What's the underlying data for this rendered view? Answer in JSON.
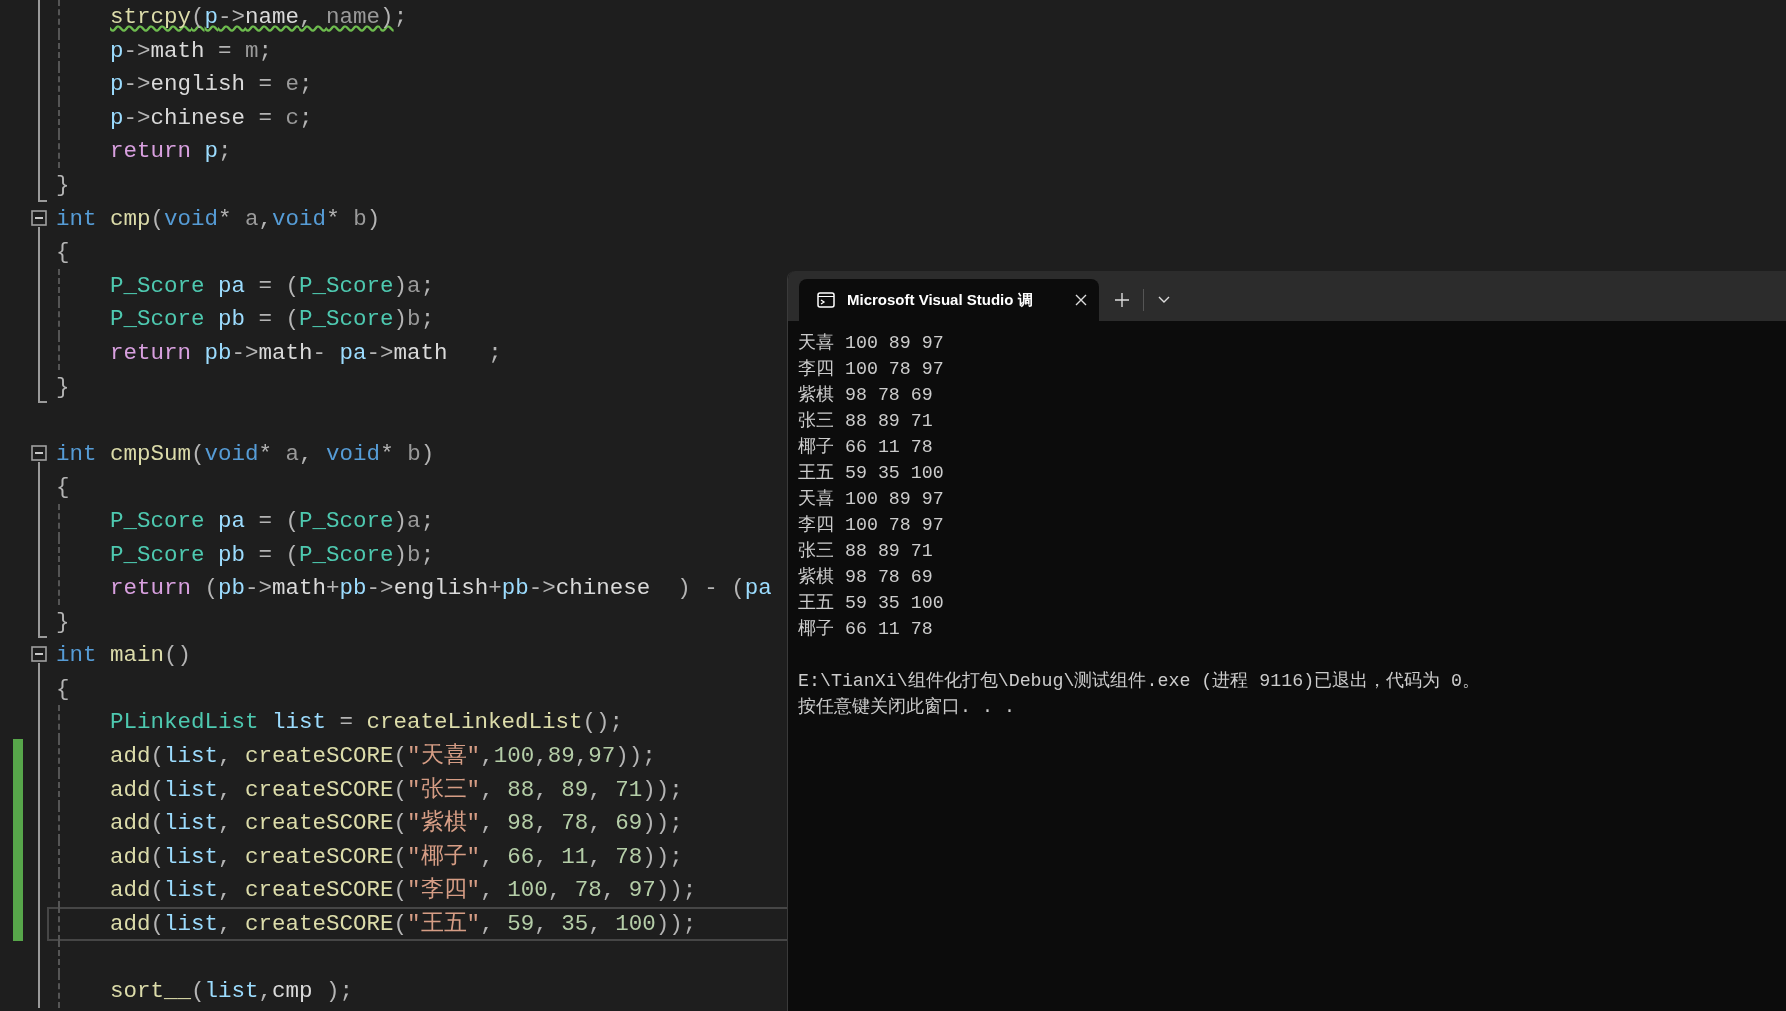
{
  "editor": {
    "lines": [
      {
        "kind": "code",
        "indented": true,
        "tokens": [
          {
            "text": "strcpy",
            "kind": "fn",
            "warning": true
          },
          {
            "text": "(",
            "kind": "op",
            "warning": true
          },
          {
            "text": "p",
            "kind": "var",
            "warning": true
          },
          {
            "text": "->",
            "kind": "op",
            "warning": true
          },
          {
            "text": "name",
            "kind": "field",
            "warning": true
          },
          {
            "text": ", ",
            "kind": "op",
            "warning": true
          },
          {
            "text": "name",
            "kind": "param",
            "warning": true
          },
          {
            "text": ")",
            "kind": "op",
            "warning": true
          },
          {
            "text": ";",
            "kind": "op"
          }
        ]
      },
      {
        "kind": "code",
        "indented": true,
        "tokens": [
          {
            "text": "p",
            "kind": "var"
          },
          {
            "text": "->",
            "kind": "op"
          },
          {
            "text": "math",
            "kind": "field"
          },
          {
            "text": " = ",
            "kind": "op"
          },
          {
            "text": "m",
            "kind": "param"
          },
          {
            "text": ";",
            "kind": "op"
          }
        ]
      },
      {
        "kind": "code",
        "indented": true,
        "tokens": [
          {
            "text": "p",
            "kind": "var"
          },
          {
            "text": "->",
            "kind": "op"
          },
          {
            "text": "english",
            "kind": "field"
          },
          {
            "text": " = ",
            "kind": "op"
          },
          {
            "text": "e",
            "kind": "param"
          },
          {
            "text": ";",
            "kind": "op"
          }
        ]
      },
      {
        "kind": "code",
        "indented": true,
        "tokens": [
          {
            "text": "p",
            "kind": "var"
          },
          {
            "text": "->",
            "kind": "op"
          },
          {
            "text": "chinese",
            "kind": "field"
          },
          {
            "text": " = ",
            "kind": "op"
          },
          {
            "text": "c",
            "kind": "param"
          },
          {
            "text": ";",
            "kind": "op"
          }
        ]
      },
      {
        "kind": "code",
        "indented": true,
        "tokens": [
          {
            "text": "return ",
            "kind": "ctl"
          },
          {
            "text": "p",
            "kind": "var"
          },
          {
            "text": ";",
            "kind": "op"
          }
        ]
      },
      {
        "kind": "code",
        "block_end": true,
        "tokens": [
          {
            "text": "}",
            "kind": "op"
          }
        ]
      },
      {
        "kind": "code",
        "fold": true,
        "tokens": [
          {
            "text": "int ",
            "kind": "kw"
          },
          {
            "text": "cmp",
            "kind": "fn"
          },
          {
            "text": "(",
            "kind": "op"
          },
          {
            "text": "void",
            "kind": "kw"
          },
          {
            "text": "* ",
            "kind": "op"
          },
          {
            "text": "a",
            "kind": "param"
          },
          {
            "text": ",",
            "kind": "op"
          },
          {
            "text": "void",
            "kind": "kw"
          },
          {
            "text": "* ",
            "kind": "op"
          },
          {
            "text": "b",
            "kind": "param"
          },
          {
            "text": ")",
            "kind": "op"
          }
        ]
      },
      {
        "kind": "code",
        "tokens": [
          {
            "text": "{",
            "kind": "op"
          }
        ]
      },
      {
        "kind": "code",
        "indented": true,
        "tokens": [
          {
            "text": "P_Score ",
            "kind": "type"
          },
          {
            "text": "pa",
            "kind": "var"
          },
          {
            "text": " = ",
            "kind": "op"
          },
          {
            "text": "(",
            "kind": "op"
          },
          {
            "text": "P_Score",
            "kind": "type"
          },
          {
            "text": ")",
            "kind": "op"
          },
          {
            "text": "a",
            "kind": "param"
          },
          {
            "text": ";",
            "kind": "op"
          }
        ]
      },
      {
        "kind": "code",
        "indented": true,
        "tokens": [
          {
            "text": "P_Score ",
            "kind": "type"
          },
          {
            "text": "pb",
            "kind": "var"
          },
          {
            "text": " = ",
            "kind": "op"
          },
          {
            "text": "(",
            "kind": "op"
          },
          {
            "text": "P_Score",
            "kind": "type"
          },
          {
            "text": ")",
            "kind": "op"
          },
          {
            "text": "b",
            "kind": "param"
          },
          {
            "text": ";",
            "kind": "op"
          }
        ]
      },
      {
        "kind": "code",
        "indented": true,
        "tokens": [
          {
            "text": "return ",
            "kind": "ctl"
          },
          {
            "text": "pb",
            "kind": "var"
          },
          {
            "text": "->",
            "kind": "op"
          },
          {
            "text": "math",
            "kind": "field"
          },
          {
            "text": "- ",
            "kind": "op"
          },
          {
            "text": "pa",
            "kind": "var"
          },
          {
            "text": "->",
            "kind": "op"
          },
          {
            "text": "math",
            "kind": "field"
          },
          {
            "text": "   ;",
            "kind": "op"
          }
        ]
      },
      {
        "kind": "code",
        "block_end": true,
        "tokens": [
          {
            "text": "}",
            "kind": "op"
          }
        ]
      },
      {
        "kind": "blank"
      },
      {
        "kind": "code",
        "fold": true,
        "tokens": [
          {
            "text": "int ",
            "kind": "kw"
          },
          {
            "text": "cmpSum",
            "kind": "fn"
          },
          {
            "text": "(",
            "kind": "op"
          },
          {
            "text": "void",
            "kind": "kw"
          },
          {
            "text": "* ",
            "kind": "op"
          },
          {
            "text": "a",
            "kind": "param"
          },
          {
            "text": ", ",
            "kind": "op"
          },
          {
            "text": "void",
            "kind": "kw"
          },
          {
            "text": "* ",
            "kind": "op"
          },
          {
            "text": "b",
            "kind": "param"
          },
          {
            "text": ")",
            "kind": "op"
          }
        ]
      },
      {
        "kind": "code",
        "tokens": [
          {
            "text": "{",
            "kind": "op"
          }
        ]
      },
      {
        "kind": "code",
        "indented": true,
        "tokens": [
          {
            "text": "P_Score ",
            "kind": "type"
          },
          {
            "text": "pa",
            "kind": "var"
          },
          {
            "text": " = ",
            "kind": "op"
          },
          {
            "text": "(",
            "kind": "op"
          },
          {
            "text": "P_Score",
            "kind": "type"
          },
          {
            "text": ")",
            "kind": "op"
          },
          {
            "text": "a",
            "kind": "param"
          },
          {
            "text": ";",
            "kind": "op"
          }
        ]
      },
      {
        "kind": "code",
        "indented": true,
        "tokens": [
          {
            "text": "P_Score ",
            "kind": "type"
          },
          {
            "text": "pb",
            "kind": "var"
          },
          {
            "text": " = ",
            "kind": "op"
          },
          {
            "text": "(",
            "kind": "op"
          },
          {
            "text": "P_Score",
            "kind": "type"
          },
          {
            "text": ")",
            "kind": "op"
          },
          {
            "text": "b",
            "kind": "param"
          },
          {
            "text": ";",
            "kind": "op"
          }
        ]
      },
      {
        "kind": "code",
        "indented": true,
        "tokens": [
          {
            "text": "return ",
            "kind": "ctl"
          },
          {
            "text": "(",
            "kind": "op"
          },
          {
            "text": "pb",
            "kind": "var"
          },
          {
            "text": "->",
            "kind": "op"
          },
          {
            "text": "math",
            "kind": "field"
          },
          {
            "text": "+",
            "kind": "op"
          },
          {
            "text": "pb",
            "kind": "var"
          },
          {
            "text": "->",
            "kind": "op"
          },
          {
            "text": "english",
            "kind": "field"
          },
          {
            "text": "+",
            "kind": "op"
          },
          {
            "text": "pb",
            "kind": "var"
          },
          {
            "text": "->",
            "kind": "op"
          },
          {
            "text": "chinese",
            "kind": "field"
          },
          {
            "text": "  ) - (",
            "kind": "op"
          },
          {
            "text": "pa",
            "kind": "var"
          }
        ]
      },
      {
        "kind": "code",
        "block_end": true,
        "tokens": [
          {
            "text": "}",
            "kind": "op"
          }
        ]
      },
      {
        "kind": "code",
        "fold": true,
        "tokens": [
          {
            "text": "int ",
            "kind": "kw"
          },
          {
            "text": "main",
            "kind": "fn"
          },
          {
            "text": "()",
            "kind": "op"
          }
        ]
      },
      {
        "kind": "code",
        "tokens": [
          {
            "text": "{",
            "kind": "op"
          }
        ]
      },
      {
        "kind": "code",
        "indented": true,
        "tokens": [
          {
            "text": "PLinkedList ",
            "kind": "type"
          },
          {
            "text": "list",
            "kind": "var"
          },
          {
            "text": " = ",
            "kind": "op"
          },
          {
            "text": "createLinkedList",
            "kind": "fn"
          },
          {
            "text": "();",
            "kind": "op"
          }
        ]
      },
      {
        "kind": "code",
        "indented": true,
        "changed": true,
        "tokens": [
          {
            "text": "add",
            "kind": "fn"
          },
          {
            "text": "(",
            "kind": "op"
          },
          {
            "text": "list",
            "kind": "var"
          },
          {
            "text": ", ",
            "kind": "op"
          },
          {
            "text": "createSCORE",
            "kind": "fn"
          },
          {
            "text": "(",
            "kind": "op"
          },
          {
            "text": "\"天喜\"",
            "kind": "str"
          },
          {
            "text": ",",
            "kind": "op"
          },
          {
            "text": "100",
            "kind": "num"
          },
          {
            "text": ",",
            "kind": "op"
          },
          {
            "text": "89",
            "kind": "num"
          },
          {
            "text": ",",
            "kind": "op"
          },
          {
            "text": "97",
            "kind": "num"
          },
          {
            "text": "));",
            "kind": "op"
          }
        ]
      },
      {
        "kind": "code",
        "indented": true,
        "changed": true,
        "tokens": [
          {
            "text": "add",
            "kind": "fn"
          },
          {
            "text": "(",
            "kind": "op"
          },
          {
            "text": "list",
            "kind": "var"
          },
          {
            "text": ", ",
            "kind": "op"
          },
          {
            "text": "createSCORE",
            "kind": "fn"
          },
          {
            "text": "(",
            "kind": "op"
          },
          {
            "text": "\"张三\"",
            "kind": "str"
          },
          {
            "text": ", ",
            "kind": "op"
          },
          {
            "text": "88",
            "kind": "num"
          },
          {
            "text": ", ",
            "kind": "op"
          },
          {
            "text": "89",
            "kind": "num"
          },
          {
            "text": ", ",
            "kind": "op"
          },
          {
            "text": "71",
            "kind": "num"
          },
          {
            "text": "));",
            "kind": "op"
          }
        ]
      },
      {
        "kind": "code",
        "indented": true,
        "changed": true,
        "tokens": [
          {
            "text": "add",
            "kind": "fn"
          },
          {
            "text": "(",
            "kind": "op"
          },
          {
            "text": "list",
            "kind": "var"
          },
          {
            "text": ", ",
            "kind": "op"
          },
          {
            "text": "createSCORE",
            "kind": "fn"
          },
          {
            "text": "(",
            "kind": "op"
          },
          {
            "text": "\"紫棋\"",
            "kind": "str"
          },
          {
            "text": ", ",
            "kind": "op"
          },
          {
            "text": "98",
            "kind": "num"
          },
          {
            "text": ", ",
            "kind": "op"
          },
          {
            "text": "78",
            "kind": "num"
          },
          {
            "text": ", ",
            "kind": "op"
          },
          {
            "text": "69",
            "kind": "num"
          },
          {
            "text": "));",
            "kind": "op"
          }
        ]
      },
      {
        "kind": "code",
        "indented": true,
        "changed": true,
        "tokens": [
          {
            "text": "add",
            "kind": "fn"
          },
          {
            "text": "(",
            "kind": "op"
          },
          {
            "text": "list",
            "kind": "var"
          },
          {
            "text": ", ",
            "kind": "op"
          },
          {
            "text": "createSCORE",
            "kind": "fn"
          },
          {
            "text": "(",
            "kind": "op"
          },
          {
            "text": "\"椰子\"",
            "kind": "str"
          },
          {
            "text": ", ",
            "kind": "op"
          },
          {
            "text": "66",
            "kind": "num"
          },
          {
            "text": ", ",
            "kind": "op"
          },
          {
            "text": "11",
            "kind": "num"
          },
          {
            "text": ", ",
            "kind": "op"
          },
          {
            "text": "78",
            "kind": "num"
          },
          {
            "text": "));",
            "kind": "op"
          }
        ]
      },
      {
        "kind": "code",
        "indented": true,
        "changed": true,
        "tokens": [
          {
            "text": "add",
            "kind": "fn"
          },
          {
            "text": "(",
            "kind": "op"
          },
          {
            "text": "list",
            "kind": "var"
          },
          {
            "text": ", ",
            "kind": "op"
          },
          {
            "text": "createSCORE",
            "kind": "fn"
          },
          {
            "text": "(",
            "kind": "op"
          },
          {
            "text": "\"李四\"",
            "kind": "str"
          },
          {
            "text": ", ",
            "kind": "op"
          },
          {
            "text": "100",
            "kind": "num"
          },
          {
            "text": ", ",
            "kind": "op"
          },
          {
            "text": "78",
            "kind": "num"
          },
          {
            "text": ", ",
            "kind": "op"
          },
          {
            "text": "97",
            "kind": "num"
          },
          {
            "text": "));",
            "kind": "op"
          }
        ]
      },
      {
        "kind": "code",
        "indented": true,
        "changed": true,
        "current": true,
        "tokens": [
          {
            "text": "add",
            "kind": "fn"
          },
          {
            "text": "(",
            "kind": "op"
          },
          {
            "text": "list",
            "kind": "var"
          },
          {
            "text": ", ",
            "kind": "op"
          },
          {
            "text": "createSCORE",
            "kind": "fn"
          },
          {
            "text": "(",
            "kind": "op"
          },
          {
            "text": "\"王五\"",
            "kind": "str"
          },
          {
            "text": ", ",
            "kind": "op"
          },
          {
            "text": "59",
            "kind": "num"
          },
          {
            "text": ", ",
            "kind": "op"
          },
          {
            "text": "35",
            "kind": "num"
          },
          {
            "text": ", ",
            "kind": "op"
          },
          {
            "text": "100",
            "kind": "num"
          },
          {
            "text": "));",
            "kind": "op"
          }
        ]
      },
      {
        "kind": "blank"
      },
      {
        "kind": "code",
        "indented": true,
        "tokens": [
          {
            "text": "sort__",
            "kind": "fn"
          },
          {
            "text": "(",
            "kind": "op"
          },
          {
            "text": "list",
            "kind": "var"
          },
          {
            "text": ",",
            "kind": "op"
          },
          {
            "text": "cmp",
            "kind": "field"
          },
          {
            "text": " );",
            "kind": "op"
          }
        ]
      }
    ]
  },
  "console": {
    "tab_title": "Microsoft Visual Studio 调",
    "output_lines": [
      "天喜 100 89 97",
      "李四 100 78 97",
      "紫棋 98 78 69",
      "张三 88 89 71",
      "椰子 66 11 78",
      "王五 59 35 100",
      "天喜 100 89 97",
      "李四 100 78 97",
      "张三 88 89 71",
      "紫棋 98 78 69",
      "王五 59 35 100",
      "椰子 66 11 78"
    ],
    "exit_lines": [
      "E:\\TianXi\\组件化打包\\Debug\\测试组件.exe (进程 9116)已退出，代码为 0。",
      "按任意键关闭此窗口. . ."
    ]
  }
}
